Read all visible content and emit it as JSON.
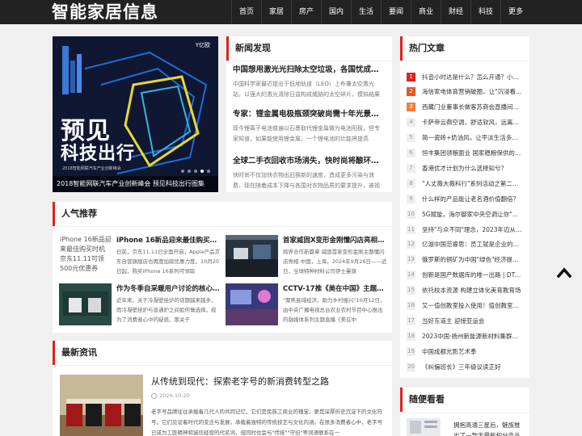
{
  "header": {
    "logo": "智能家居信息",
    "nav": [
      "首页",
      "家居",
      "房产",
      "国内",
      "生活",
      "要闻",
      "商业",
      "财经",
      "科技",
      "更多"
    ]
  },
  "hero": {
    "caption": "2018智能网联汽车产业创新峰会 预见科技出行图集",
    "big1": "预见",
    "big2": "科技出行",
    "sub": "2018智能网联汽车产业创新峰会",
    "brand": "Y亿欧"
  },
  "news_discovery": {
    "title": "新闻发现",
    "items": [
      {
        "title": "中国想用激光光扫除太空垃圾，各国忧成强…",
        "desc": "中国科学家最近提出于低地轨道（LEO）上布署太空激光站，以强大的激光清除日益构成威胁的太空碎片，模拟结果"
      },
      {
        "title": "专家：锂金属电极瓶颈突破尚需十年光景，…",
        "desc": "现今锂离子电池普遍以石墨取代锂金属做为电池阳极，但专家知道，如果能使用锂金属，一个锂电池的比能将提高"
      },
      {
        "title": "全球二手衣回收市场消失，快时尚将酿环境…",
        "desc": "快时尚不仅加快衣物出旧换新的速度，造成更多污染与浪费，现在随着成本下降与各国对衣物品质的要求提升，被视"
      }
    ]
  },
  "popular": {
    "title": "人气推荐",
    "items": [
      {
        "title": "iPhone 16新品迎来最佳购买时机…",
        "desc": "日前，京东11.11已全面开启，Apple产品京东自营旗舰店也再度加磅优惠力度。10月20日起，购买iPhone 16系列可领取",
        "alt": "iPhone 16新品迎来最佳购买时机 京东11.11可领500元优惠券"
      },
      {
        "title": "首家威固X变形金刚懂闪店亮相上海",
        "desc": "跨界合作新篇章 威固首家变形金刚主题懂闪店亮相 中国，上海，2024年9月26日——近日，全球特种材料公司伊士曼旗",
        "alt": ""
      },
      {
        "title": "作为冬季自采暖用户讨论的核心…",
        "desc": "近年来，关于冷凝壁挂炉的话题越来越多，而冷凝壁挂炉与普通炉之间如何做选择，成为了消费者心中的疑惑，那关于",
        "alt": ""
      },
      {
        "title": "CCTV-17推《美在中国》主题直…",
        "desc": "\"聚焦县域经济，助力乡村振兴\"10月12日，由中央广播电视总台农业农村节目中心推出的融媒体系列主题直播《美在中",
        "alt": ""
      }
    ]
  },
  "latest": {
    "title": "最新资讯",
    "item": {
      "title": "从传统到现代：探索老字号的新消费转型之路",
      "date": "2024-10-20",
      "desc": "老字号品牌往往承载着几代人的共同记忆，它们是民族工商业的瑰宝，更是深厚历史沉淀下的文化符号。它们见证着时代的变迁与发展，承载着独特的传统技艺与文化内涵。在很多消费者心中，老字号已成为工匠精神和诚信经营的代名词，但同时也会与\"传统\"\"守旧\"等词语联系在一"
    }
  },
  "hot": {
    "title": "热门文章",
    "items": [
      "抖音小时达是什么？怎么开通？小时…",
      "海信家电体育营销破圈，让\"沉浸看亚…",
      "西藏门业董事长做客苏商会直播间专访",
      "卡萨帝云鼎空调，舒适软风，远离空…",
      "简一瓷砖+奶油风，让平淡生活多一…",
      "恒丰集团领粮面业 国家稳粮保供的\"压…",
      "香港优才计划为什么选择知兮？",
      "\"人丈薇大薇科行\"系列活动之第二届全…",
      "什么样的产品能让老名酒价值翻倍？",
      "5G赋能，海尔御家中央空调让你\"畅…",
      "坚持\"与众不同\"理念，2023年迈从不…",
      "亿滋中国范睿思：员工就是企业的核…",
      "俄罗斯的铜矿为中国\"绿色\"经济提供…",
      "创新是国产数据库的唯一出路 | DTC…",
      "依托校本资源 构建立体化美育教育场",
      "又一值创教室投入使用！值创教室打…",
      "当好东道主 迎接亚运会",
      "2023中国·扬州新能源新材料集群产…",
      "中国成都光影艺术季",
      "《纠偏班长》三年级议读正好"
    ]
  },
  "random": {
    "title": "随便看看",
    "item": "拥抱高通三星后，魅族推出了一款无最新积分产品"
  },
  "colors": {
    "accent": "#e02020",
    "header_bg": "#222222",
    "page_bg": "#f0f0f0"
  },
  "icons": {
    "back_to_top": "chevron-up-icon"
  }
}
